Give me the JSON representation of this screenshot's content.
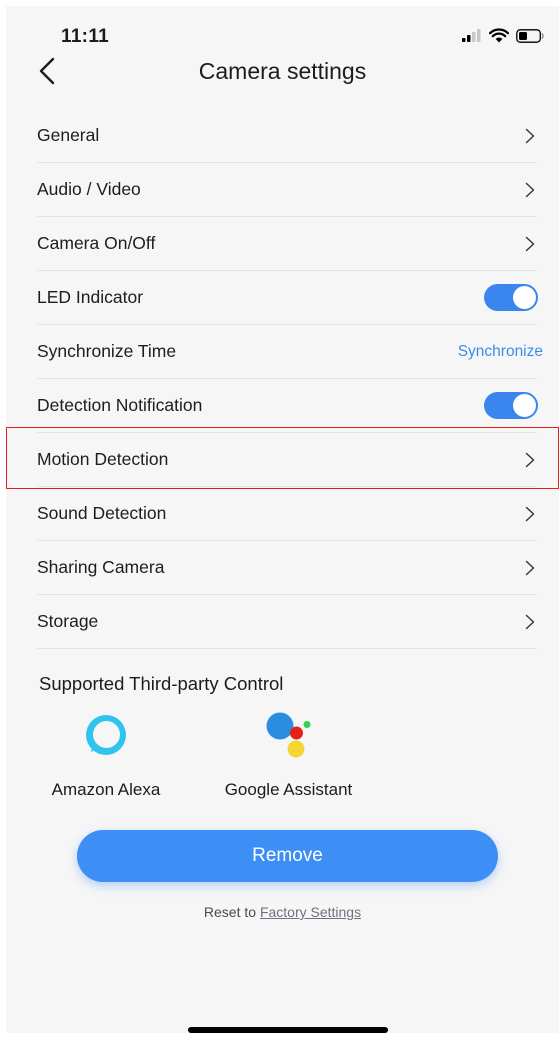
{
  "status_bar": {
    "time": "11:11"
  },
  "header": {
    "title": "Camera settings"
  },
  "settings": [
    {
      "label": "General",
      "control": "chevron"
    },
    {
      "label": "Audio / Video",
      "control": "chevron"
    },
    {
      "label": "Camera On/Off",
      "control": "chevron"
    },
    {
      "label": "LED Indicator",
      "control": "toggle",
      "on": true
    },
    {
      "label": "Synchronize Time",
      "control": "link",
      "link_label": "Synchronize"
    },
    {
      "label": "Detection Notification",
      "control": "toggle",
      "on": true
    },
    {
      "label": "Motion Detection",
      "control": "chevron",
      "highlighted": true
    },
    {
      "label": "Sound Detection",
      "control": "chevron"
    },
    {
      "label": "Sharing Camera",
      "control": "chevron"
    },
    {
      "label": "Storage",
      "control": "chevron"
    }
  ],
  "third_party": {
    "title": "Supported Third-party Control",
    "items": [
      {
        "label": "Amazon Alexa",
        "icon": "alexa-icon"
      },
      {
        "label": "Google Assistant",
        "icon": "google-assistant-icon"
      }
    ]
  },
  "remove_button": "Remove",
  "reset": {
    "prefix": "Reset to ",
    "link": "Factory Settings"
  },
  "colors": {
    "accent": "#3a86ee",
    "highlight_border": "#e2231a",
    "background": "#f6f6f7"
  }
}
